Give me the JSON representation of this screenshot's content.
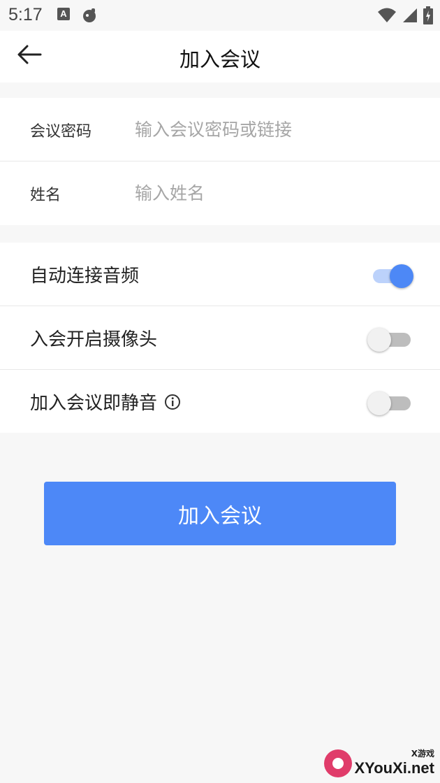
{
  "status_bar": {
    "time": "5:17",
    "left_icons": [
      "accessibility-a-icon",
      "app-notification-icon"
    ],
    "right_icons": [
      "wifi-icon",
      "cell-signal-icon",
      "battery-charging-icon"
    ]
  },
  "header": {
    "title": "加入会议",
    "back_icon": "arrow-left-icon"
  },
  "form": {
    "password": {
      "label": "会议密码",
      "placeholder": "输入会议密码或链接",
      "value": ""
    },
    "name": {
      "label": "姓名",
      "placeholder": "输入姓名",
      "value": ""
    }
  },
  "settings": {
    "auto_audio": {
      "label": "自动连接音频",
      "enabled": true
    },
    "camera_on": {
      "label": "入会开启摄像头",
      "enabled": false
    },
    "mute_on_join": {
      "label": "加入会议即静音",
      "enabled": false,
      "info_icon": "info-circle-icon"
    }
  },
  "join_button": {
    "label": "加入会议"
  },
  "watermark": {
    "small": "X游戏",
    "big": "XYouXi.net"
  },
  "colors": {
    "accent": "#4d88f7",
    "switch_on_track": "#bcd2fb",
    "switch_off_track": "#bdbdbd",
    "background": "#f7f7f7",
    "card": "#ffffff",
    "placeholder": "#a6a6a6"
  }
}
